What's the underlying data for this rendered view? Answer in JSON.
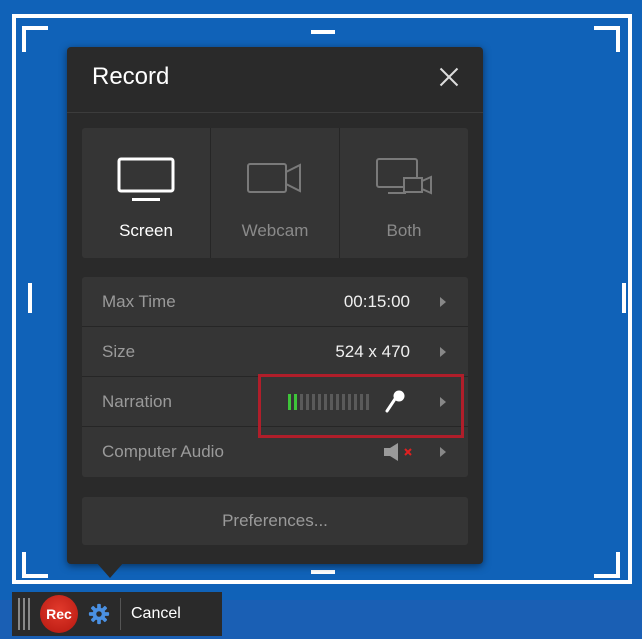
{
  "panel": {
    "title": "Record",
    "close_icon": "close-icon"
  },
  "modes": [
    {
      "label": "Screen",
      "icon": "monitor-icon",
      "active": true
    },
    {
      "label": "Webcam",
      "icon": "webcam-icon",
      "active": false
    },
    {
      "label": "Both",
      "icon": "screen-webcam-icon",
      "active": false
    }
  ],
  "settings": {
    "max_time": {
      "label": "Max Time",
      "value": "00:15:00"
    },
    "size": {
      "label": "Size",
      "value": "524 x 470"
    },
    "narration": {
      "label": "Narration",
      "level": 0.15,
      "icon": "microphone-icon"
    },
    "computer_audio": {
      "label": "Computer Audio",
      "icon": "speaker-muted-icon",
      "muted": true
    }
  },
  "preferences_label": "Preferences...",
  "toolbar": {
    "rec_label": "Rec",
    "cancel_label": "Cancel",
    "gear_icon": "gear-icon"
  },
  "colors": {
    "background": "#1062b8",
    "panel": "#2a2a2a",
    "section": "#353535",
    "rec": "#c8201a",
    "highlight": "#b01e2a",
    "meter_active": "#3ec43a",
    "mute_x": "#e02020"
  }
}
